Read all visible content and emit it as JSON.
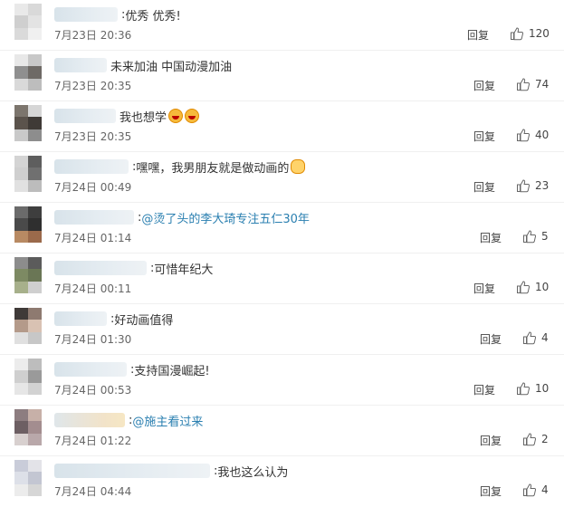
{
  "comments": [
    {
      "text": "优秀 优秀!",
      "mention": "",
      "time": "7月23日 20:36",
      "reply": "回复",
      "likes": "120",
      "colon": ":",
      "emoji": ""
    },
    {
      "text": "未来加油 中国动漫加油",
      "mention": "",
      "time": "7月23日 20:35",
      "reply": "回复",
      "likes": "74",
      "colon": "",
      "emoji": ""
    },
    {
      "text": "我也想学",
      "mention": "",
      "time": "7月23日 20:35",
      "reply": "回复",
      "likes": "40",
      "colon": "",
      "emoji": "laugh-laugh"
    },
    {
      "text": "嘿嘿，我男朋友就是做动画的",
      "mention": "",
      "time": "7月24日 00:49",
      "reply": "回复",
      "likes": "23",
      "colon": ":",
      "emoji": "cat"
    },
    {
      "text": "",
      "mention": "@烫了头的李大琦专注五仁30年",
      "time": "7月24日 01:14",
      "reply": "回复",
      "likes": "5",
      "colon": ":",
      "emoji": ""
    },
    {
      "text": "可惜年纪大",
      "mention": "",
      "time": "7月24日 00:11",
      "reply": "回复",
      "likes": "10",
      "colon": ":",
      "emoji": ""
    },
    {
      "text": "好动画值得",
      "mention": "",
      "time": "7月24日 01:30",
      "reply": "回复",
      "likes": "4",
      "colon": ":",
      "emoji": ""
    },
    {
      "text": "支持国漫崛起!",
      "mention": "",
      "time": "7月24日 00:53",
      "reply": "回复",
      "likes": "10",
      "colon": ":",
      "emoji": ""
    },
    {
      "text": "",
      "mention": "@施主看过来",
      "time": "7月24日 01:22",
      "reply": "回复",
      "likes": "2",
      "colon": ":",
      "emoji": ""
    },
    {
      "text": "我也这么认为",
      "mention": "",
      "time": "7月24日 04:44",
      "reply": "回复",
      "likes": "4",
      "colon": ":",
      "emoji": ""
    }
  ],
  "icons": {
    "like": "thumbs-up-icon"
  },
  "colors": {
    "mention": "#2a7fb0",
    "text": "#333333",
    "meta": "#666666"
  }
}
